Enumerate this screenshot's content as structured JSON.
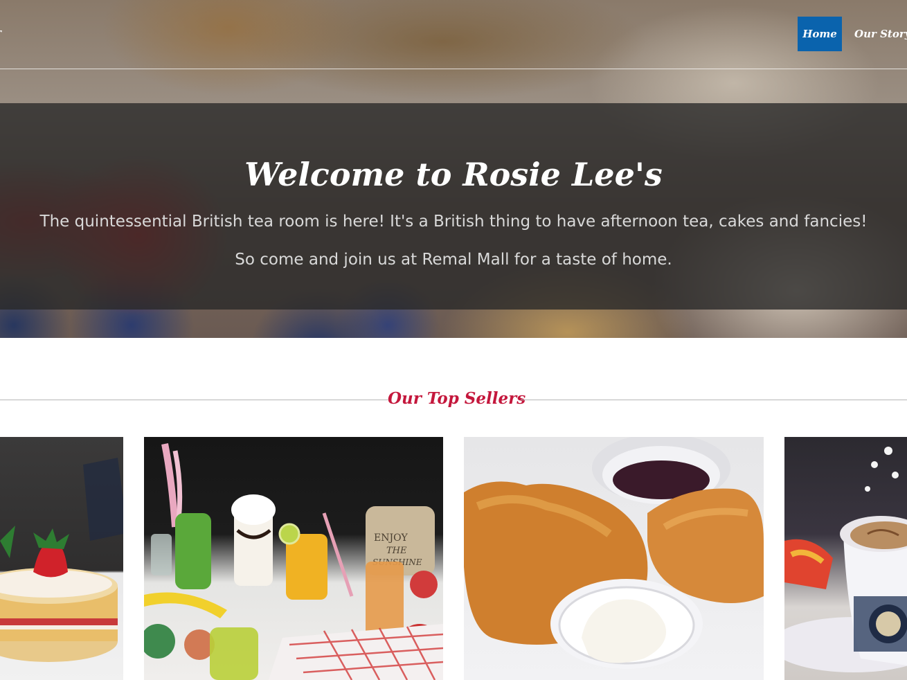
{
  "nav": {
    "cut_label": "r",
    "home_label": "Home",
    "story_label": "Our Story"
  },
  "hero": {
    "title": "Welcome to Rosie Lee's",
    "line1": "The quintessential British tea room is here! It's a British thing to have afternoon tea, cakes and fancies!",
    "line2": "So come and join us at Remal Mall for a taste of home."
  },
  "section": {
    "title": "Our Top Sellers"
  },
  "colors": {
    "nav_active": "#0a63ad",
    "accent_red": "#c4173c",
    "overlay": "#282828"
  },
  "gallery": {
    "items": [
      {
        "subject": "victoria sponge cake with strawberry"
      },
      {
        "subject": "fruit drinks and milkshake with ENJOY THE SUNSHINE block"
      },
      {
        "subject": "scones with jam and clotted cream"
      },
      {
        "subject": "cappuccino in royal teacup"
      }
    ]
  }
}
